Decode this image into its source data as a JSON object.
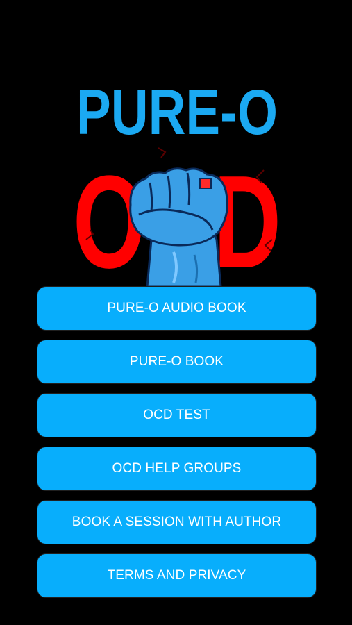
{
  "app": {
    "logo": {
      "title_text": "PURE-O",
      "emblem_text": "OCD",
      "icon": "raised-fist-icon",
      "colors": {
        "title": "#1ba9f2",
        "emblem": "#ff0000",
        "fist": "#3a9fe6"
      }
    }
  },
  "menu": {
    "items": [
      {
        "label": "PURE-O AUDIO BOOK"
      },
      {
        "label": "PURE-O BOOK"
      },
      {
        "label": "OCD TEST"
      },
      {
        "label": "OCD HELP GROUPS"
      },
      {
        "label": "BOOK A SESSION WITH AUTHOR"
      },
      {
        "label": "TERMS AND PRIVACY"
      }
    ]
  },
  "theme": {
    "background": "#000000",
    "button_color": "#08aefc",
    "button_text_color": "#ffffff"
  }
}
